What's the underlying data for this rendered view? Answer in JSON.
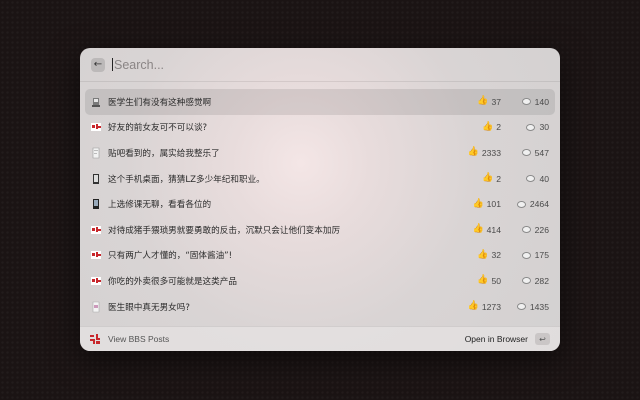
{
  "search": {
    "placeholder": "Search..."
  },
  "back_icon": "arrow-left-icon",
  "posts": [
    {
      "title": "医学生们有没有这种感觉啊",
      "likes": "37",
      "comments": "140",
      "icon": "post-thumbnail-icon",
      "selected": true
    },
    {
      "title": "好友的前女友可不可以谈?",
      "likes": "2",
      "comments": "30",
      "icon": "post-thumbnail-icon"
    },
    {
      "title": "贴吧看到的，属实给我整乐了",
      "likes": "2333",
      "comments": "547",
      "icon": "post-thumbnail-icon"
    },
    {
      "title": "这个手机桌面，猜猜LZ多少年纪和职业。",
      "likes": "2",
      "comments": "40",
      "icon": "post-thumbnail-icon"
    },
    {
      "title": "上选修课无聊，看看各位的",
      "likes": "101",
      "comments": "2464",
      "icon": "post-thumbnail-icon"
    },
    {
      "title": "对待成猪手猥琐男就要勇敢的反击，沉默只会让他们变本加厉",
      "likes": "414",
      "comments": "226",
      "icon": "post-thumbnail-icon"
    },
    {
      "title": "只有两广人才懂的，“固体酱油”!",
      "likes": "32",
      "comments": "175",
      "icon": "post-thumbnail-icon"
    },
    {
      "title": "你吃的外卖很多可能就是这类产品",
      "likes": "50",
      "comments": "282",
      "icon": "post-thumbnail-icon"
    },
    {
      "title": "医生眼中真无男女吗?",
      "likes": "1273",
      "comments": "1435",
      "icon": "post-thumbnail-icon"
    }
  ],
  "footer": {
    "label": "View BBS Posts",
    "action": "Open in Browser",
    "enter_symbol": "↩",
    "logo_icon": "bbs-logo-icon"
  },
  "colors": {
    "like": "#e0a52a",
    "logo_red": "#c8262b"
  }
}
